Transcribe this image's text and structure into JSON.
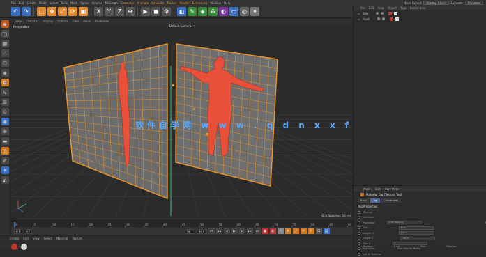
{
  "menubar": {
    "items": [
      "File",
      "Edit",
      "Create",
      "Mode",
      "Select",
      "Tools",
      "Mesh",
      "Spline",
      "Volume",
      "MoGraph",
      "Character",
      "Animate",
      "Simulate",
      "Tracker",
      "Render",
      "Extensions",
      "Window",
      "Help"
    ],
    "highlighted": [
      "Character",
      "Animate",
      "Simulate",
      "Tracker",
      "Render",
      "Extensions"
    ],
    "layout_label": "Node Layout",
    "layout_value": "Startup (User)",
    "layouts_label": "Layouts:",
    "layouts_value": "Standard"
  },
  "viewport": {
    "menu": [
      "View",
      "Cameras",
      "Display",
      "Options",
      "Filter",
      "Panel",
      "ProRender"
    ],
    "label": "Perspective",
    "camera": "Default Camera ·•",
    "grid_spacing": "Grid Spacing : 50 cm",
    "watermark": "软件自学网 w w w . q d n x x f b . c n"
  },
  "timeline": {
    "ticks": [
      "0",
      "5",
      "10",
      "15",
      "20",
      "25",
      "30",
      "35",
      "40",
      "45",
      "50",
      "55",
      "60",
      "65",
      "70",
      "75",
      "80",
      "85",
      "90"
    ],
    "start": "0 F",
    "current": "0 F",
    "end": "90 F",
    "end2": "90 F"
  },
  "material_manager": {
    "menu": [
      "Create",
      "Edit",
      "View",
      "Select",
      "Material",
      "Texture"
    ],
    "swatch_colors": [
      "#c0392b",
      "#d8d8d8"
    ]
  },
  "object_manager": {
    "menu": [
      "File",
      "Edit",
      "View",
      "Object",
      "Tags",
      "Bookmarks"
    ],
    "objects": [
      {
        "name": "Side",
        "color": "#55c0ff"
      },
      {
        "name": "Front",
        "color": "#55c0ff"
      }
    ]
  },
  "attribute_manager": {
    "menu": [
      "Mode",
      "Edit",
      "User Data"
    ],
    "title": "Material Tag [Texture Tag]",
    "tabs": [
      "Basic",
      "Tag",
      "Coordinates"
    ],
    "active_tab": "Tag",
    "section": "Tag Properties",
    "rows": [
      {
        "label": "Material",
        "value": "",
        "label2": ""
      },
      {
        "label": "Selection",
        "value": "",
        "label2": ""
      },
      {
        "label": "Projection",
        "value": "UVW Mapping",
        "label2": "Projection Display"
      },
      {
        "label": "Side",
        "value": "Both",
        "label2": "Offset U"
      },
      {
        "label": "Length U",
        "value": "100 %",
        "label2": "Offset V"
      },
      {
        "label": "Length V",
        "value": "100 %",
        "label2": "Tiles U"
      },
      {
        "label": "Tiles V",
        "value": "1",
        "label2": "Repetitions U"
      },
      {
        "label": "Seamless",
        "value": "",
        "label2": "Use UVW for Bump"
      },
      {
        "label": "Add to Material",
        "value": "",
        "label2": ""
      }
    ],
    "footer": {
      "x_label": "Position",
      "x_value": "0 cm",
      "size_label": "Size",
      "rot_label": "Rotation"
    }
  },
  "colors": {
    "plane_border": "#e8942a",
    "grid_line": "#e8942a",
    "figure": "#e8503a",
    "accent": "#4a6a9a"
  }
}
